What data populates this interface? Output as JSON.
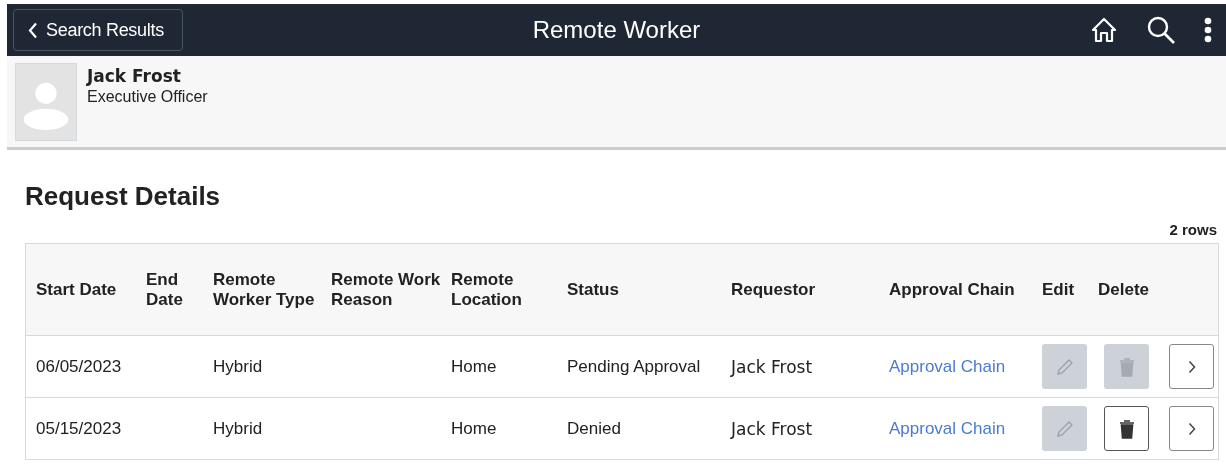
{
  "header": {
    "back_button": "Search Results",
    "title": "Remote Worker"
  },
  "person": {
    "name": "Jack Frost",
    "job_title": "Executive Officer"
  },
  "section_title": "Request Details",
  "row_count": "2 rows",
  "table": {
    "columns": [
      "Start Date",
      "End Date",
      "Remote Worker Type",
      "Remote Work Reason",
      "Remote Location",
      "Status",
      "Requestor",
      "Approval Chain",
      "Edit",
      "Delete"
    ],
    "rows": [
      {
        "start_date": "06/05/2023",
        "worker_type": "Hybrid",
        "location": "Home",
        "status": "Pending Approval",
        "requestor": "Jack Frost",
        "approval_chain": "Approval Chain",
        "edit_disabled": true,
        "delete_disabled": true
      },
      {
        "start_date": "05/15/2023",
        "worker_type": "Hybrid",
        "location": "Home",
        "status": "Denied",
        "requestor": "Jack Frost",
        "approval_chain": "Approval Chain",
        "edit_disabled": true,
        "delete_disabled": false
      }
    ]
  }
}
